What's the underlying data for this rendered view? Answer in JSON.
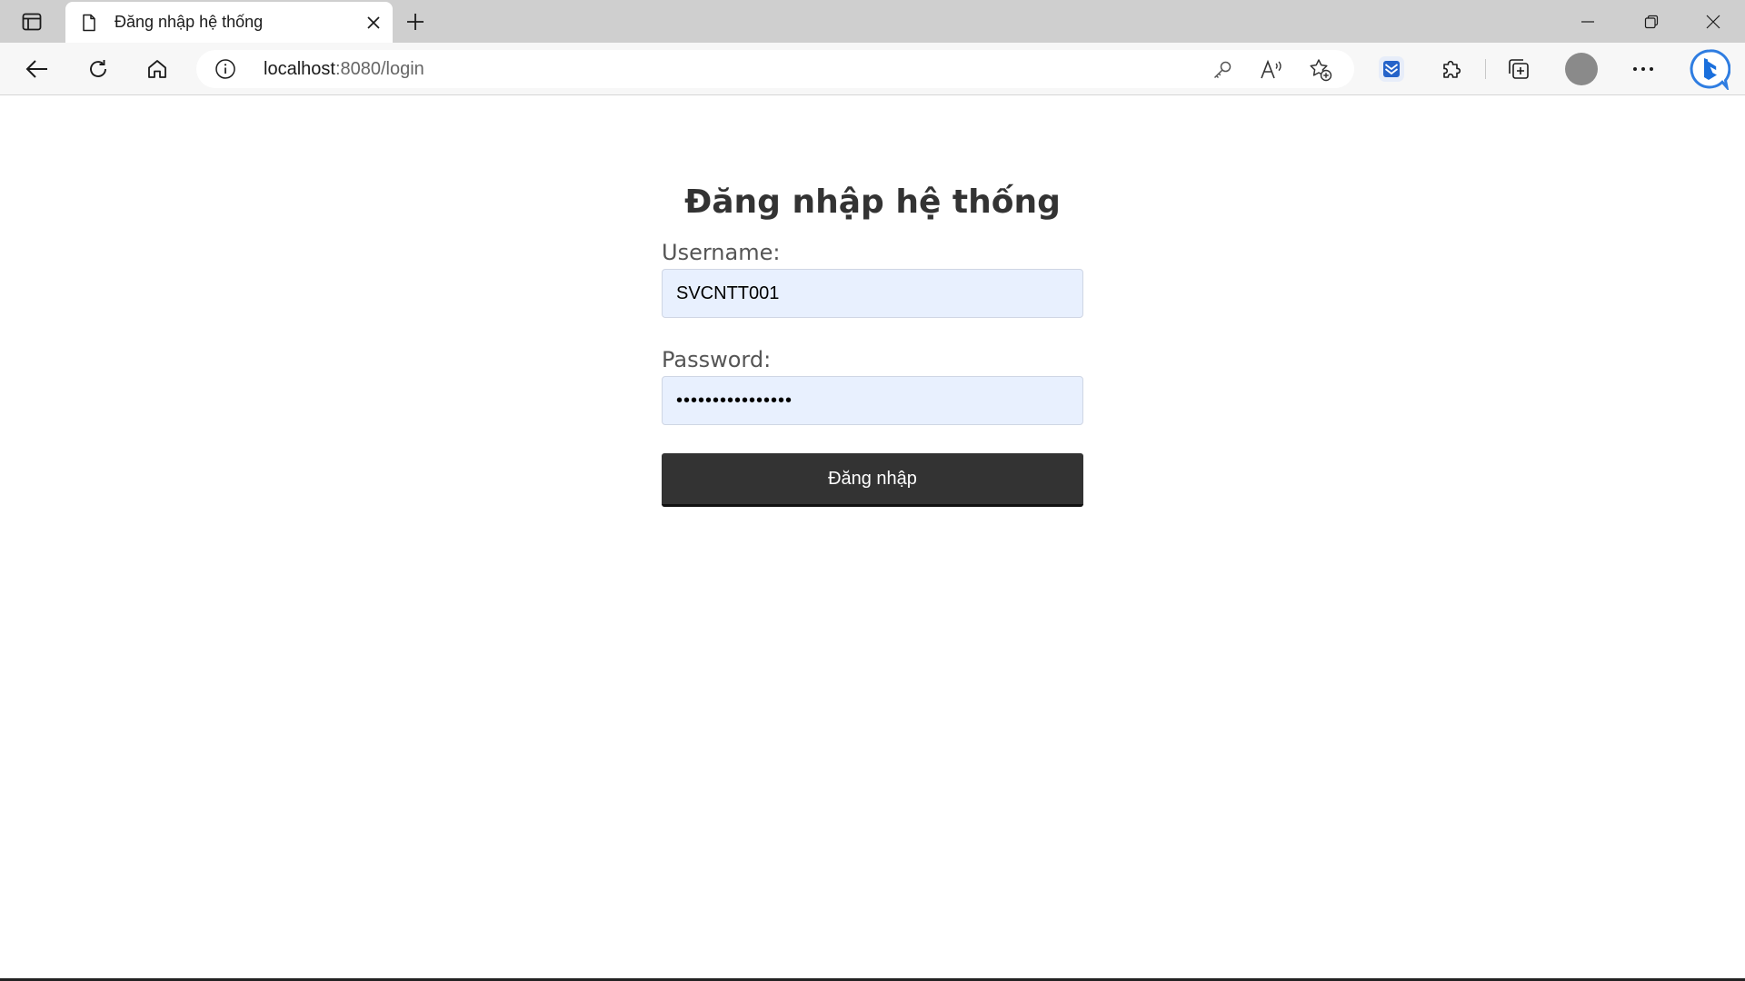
{
  "browser": {
    "tab": {
      "title": "Đăng nhập hệ thống"
    },
    "address": {
      "host": "localhost",
      "rest": ":8080/login"
    }
  },
  "page": {
    "heading": "Đăng nhập hệ thống",
    "username": {
      "label": "Username:",
      "value": "SVCNTT001"
    },
    "password": {
      "label": "Password:",
      "value": "••••••••••••••••"
    },
    "submit_label": "Đăng nhập"
  },
  "icons": {
    "tab_actions": "tab-actions-icon",
    "favicon": "page-icon",
    "close": "close-icon",
    "new_tab": "plus-icon",
    "back": "back-arrow-icon",
    "refresh": "refresh-icon",
    "home": "home-icon",
    "site_info": "info-icon",
    "password_key": "key-icon",
    "read_aloud": "read-aloud-icon",
    "favorite": "star-add-icon",
    "extension_blue": "mail-extension-icon",
    "extensions": "puzzle-icon",
    "collections": "collections-icon",
    "more": "more-icon",
    "copilot": "bing-icon"
  },
  "colors": {
    "button_bg": "#333333",
    "input_bg": "#e8f0fe",
    "tabstrip": "#cfcfcf"
  }
}
